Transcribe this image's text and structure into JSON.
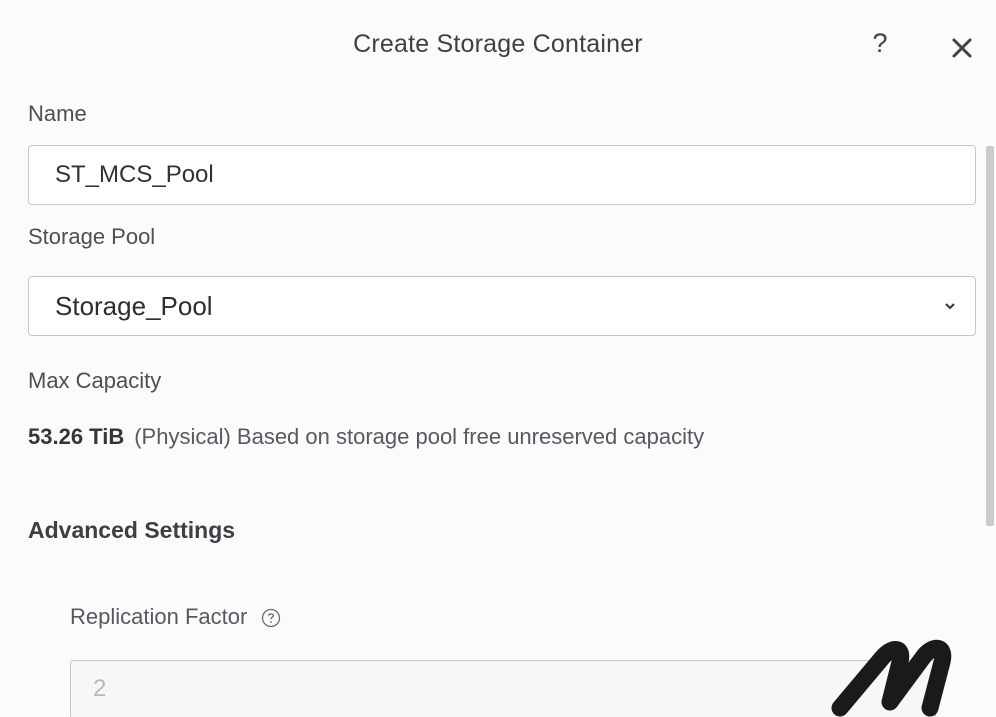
{
  "dialog": {
    "title": "Create Storage Container",
    "help_label": "?"
  },
  "form": {
    "name_label": "Name",
    "name_value": "ST_MCS_Pool",
    "storage_pool_label": "Storage Pool",
    "storage_pool_value": "Storage_Pool",
    "max_capacity_label": "Max Capacity",
    "max_capacity_amount": "53.26 TiB",
    "max_capacity_note": "(Physical) Based on storage pool free unreserved capacity",
    "advanced_settings_title": "Advanced Settings",
    "replication_factor_label": "Replication Factor",
    "replication_factor_value": "2"
  },
  "colors": {
    "border": "#c4c8cc",
    "text": "#3a3f44",
    "watermark": "#1a1a1a"
  },
  "icons": {
    "help": "question-mark",
    "close": "close-x",
    "dropdown": "chevron-down",
    "info": "circled-question-mark"
  }
}
